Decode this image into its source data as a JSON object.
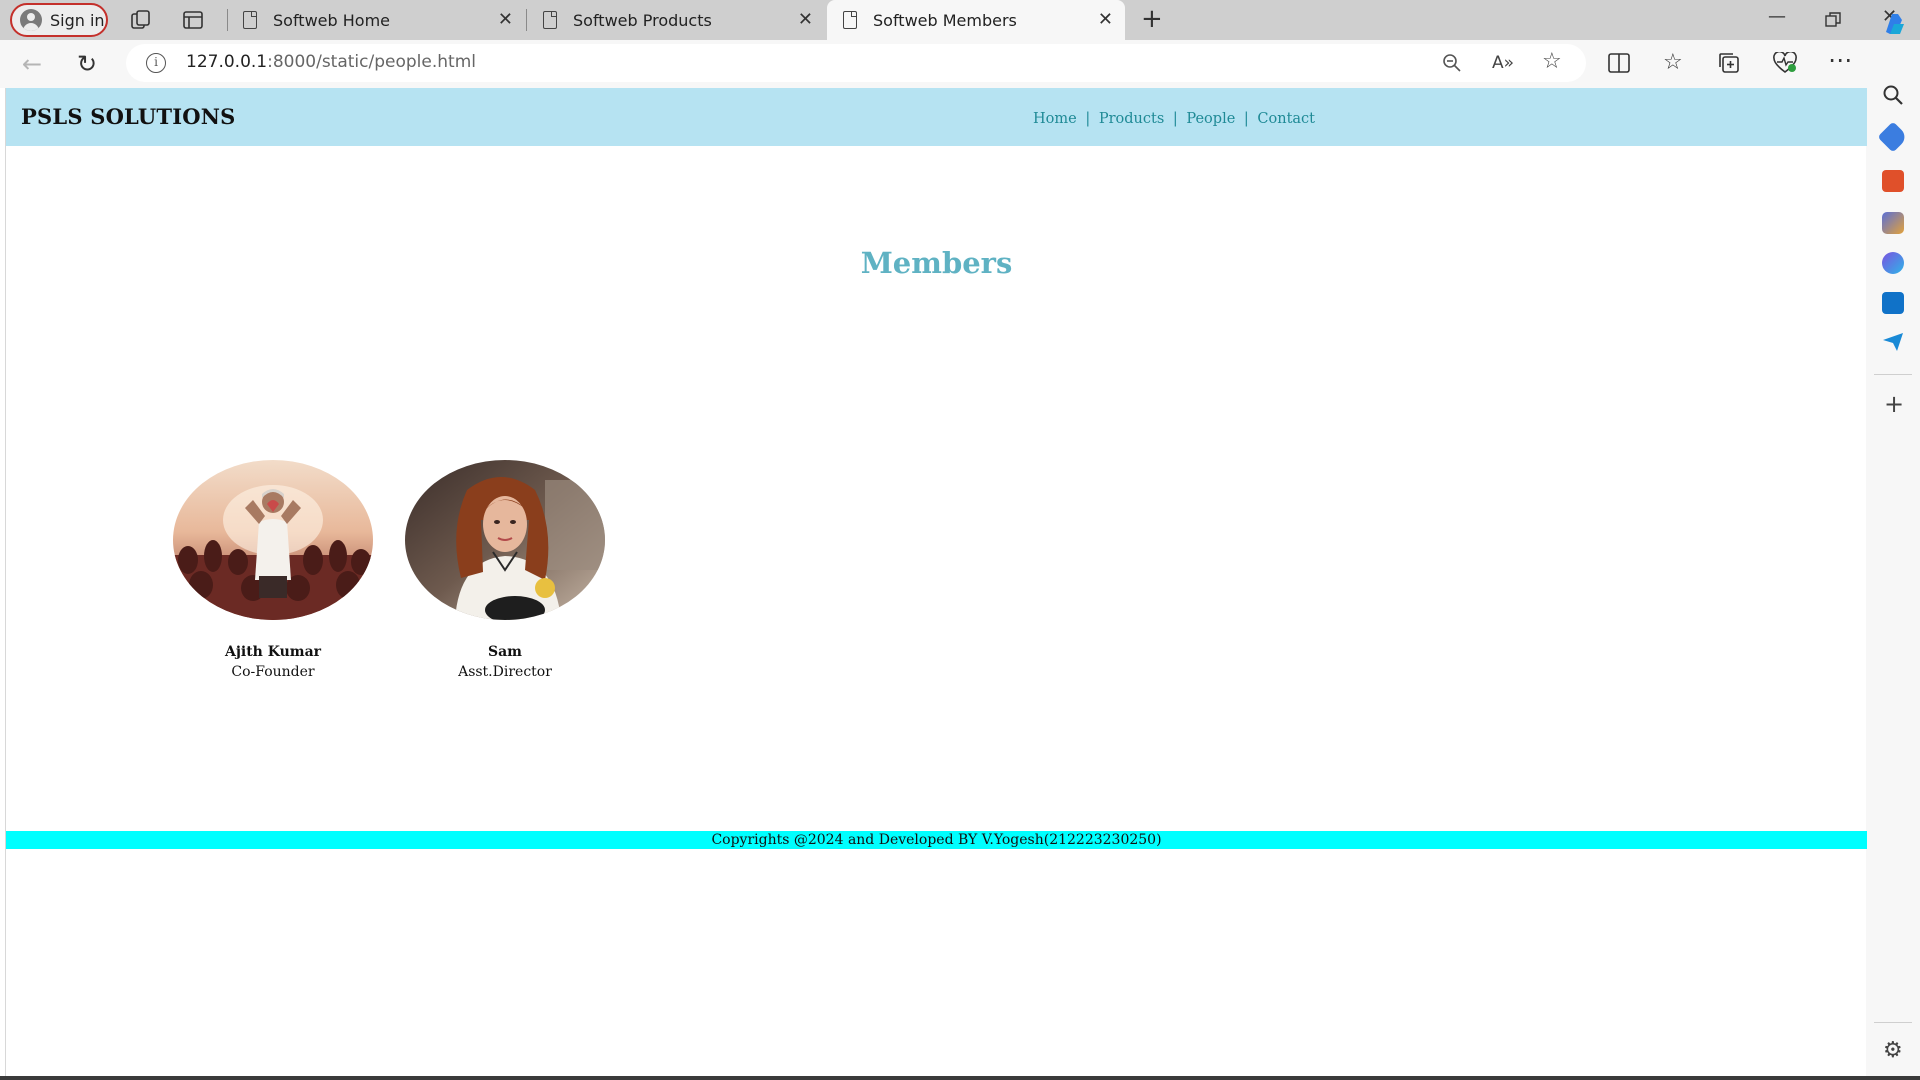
{
  "browser": {
    "signin_label": "Sign in",
    "tabs": [
      {
        "title": "Softweb Home",
        "active": false
      },
      {
        "title": "Softweb Products",
        "active": false
      },
      {
        "title": "Softweb Members",
        "active": true
      }
    ],
    "address": {
      "host": "127.0.0.1",
      "path": ":8000/static/people.html"
    }
  },
  "site": {
    "brand": "PSLS SOLUTIONS",
    "nav": {
      "home": "Home",
      "products": "Products",
      "people": "People",
      "contact": "Contact",
      "separator": "|"
    },
    "heading": "Members",
    "members": [
      {
        "name": "Ajith Kumar",
        "role": "Co-Founder"
      },
      {
        "name": "Sam",
        "role": "Asst.Director"
      }
    ],
    "footer": "Copyrights @2024 and Developed BY V.Yogesh(212223230250)"
  },
  "colors": {
    "header_bg": "#b6e3f2",
    "nav_link": "#1f8a96",
    "heading": "#5fb2c3",
    "footer_bg": "#00ffff"
  }
}
